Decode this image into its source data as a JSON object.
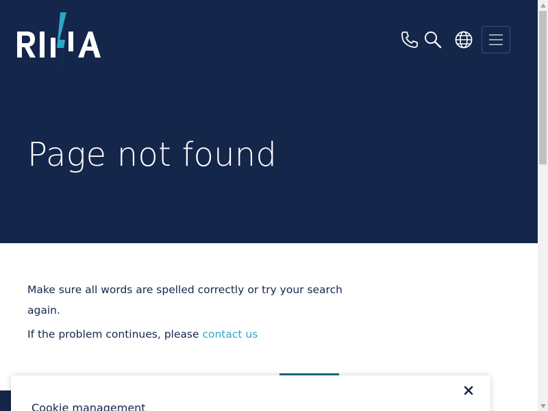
{
  "brand": {
    "logo_text": "RINA",
    "colors": {
      "navy": "#14264a",
      "accent": "#2aa7c9",
      "teal": "#1b6c84"
    }
  },
  "header": {
    "icons": [
      "phone-icon",
      "search-icon",
      "globe-icon",
      "hamburger-menu-icon"
    ]
  },
  "hero": {
    "title": "Page not found"
  },
  "content": {
    "message": "Make sure all words are spelled correctly or try your search again.",
    "problem_prefix": "If the problem continues, please ",
    "contact_link": "contact us"
  },
  "cookie_banner": {
    "title": "Cookie management",
    "close_icon": "close-icon"
  }
}
